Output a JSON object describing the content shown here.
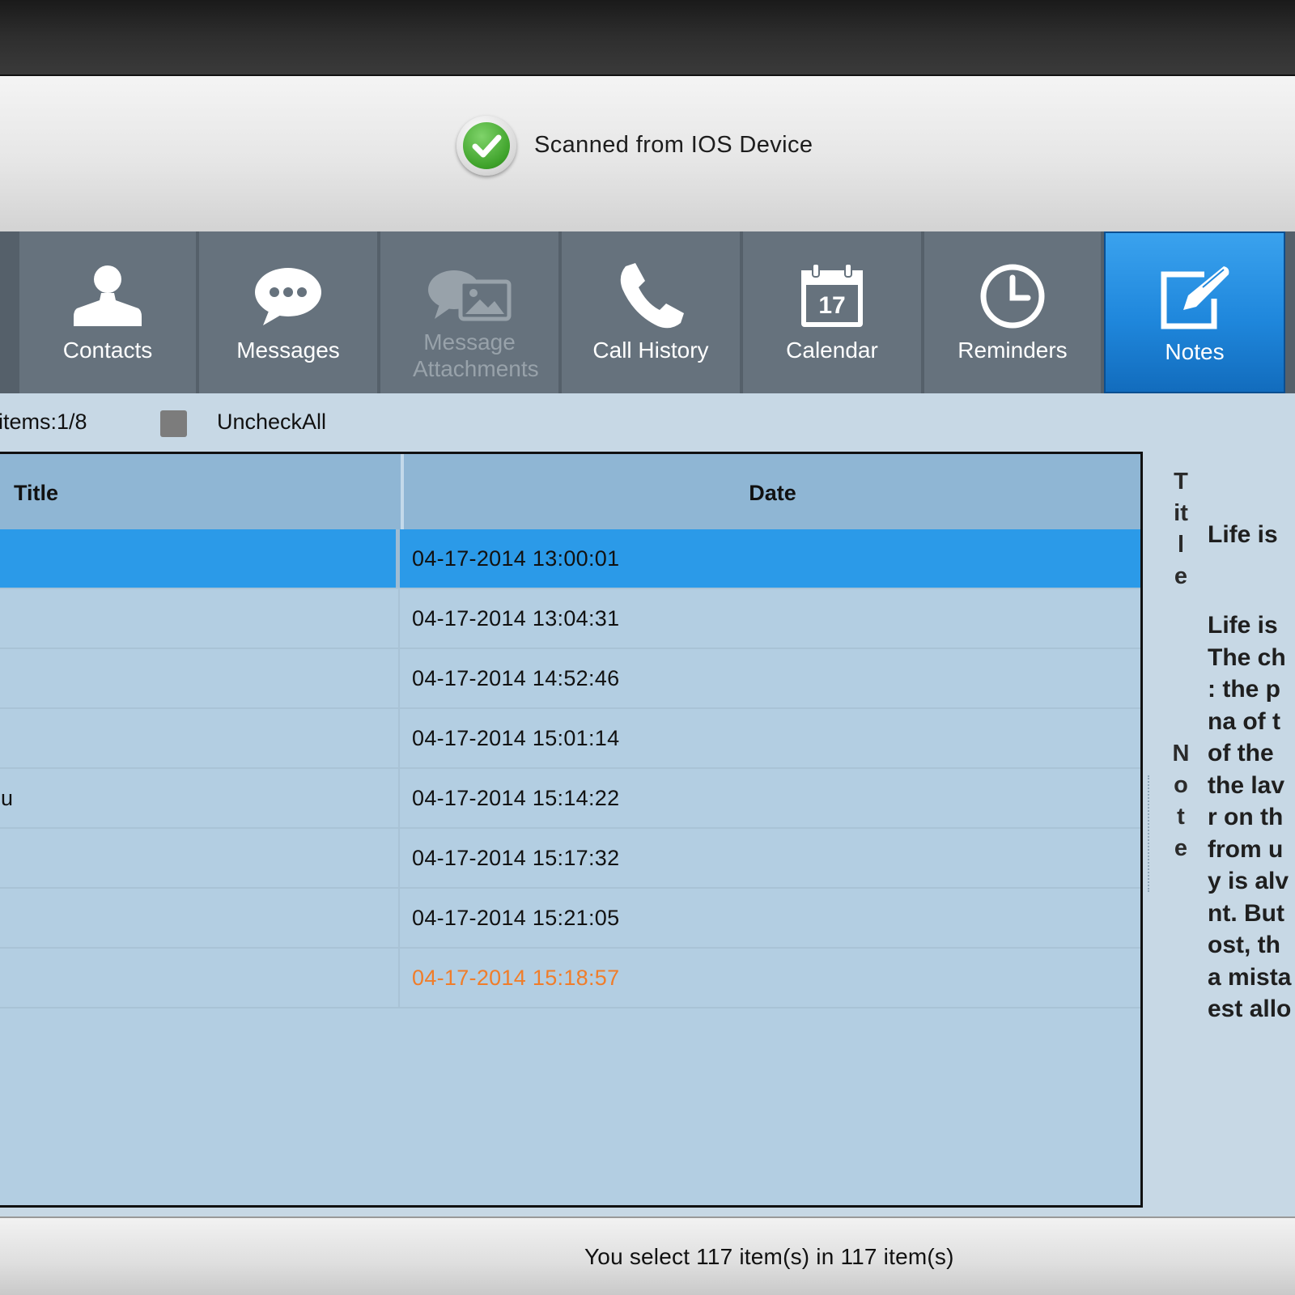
{
  "status": {
    "text": "Scanned from IOS Device"
  },
  "tabs": [
    {
      "label": "Contacts",
      "icon": "contacts-icon",
      "disabled": false,
      "active": false
    },
    {
      "label": "Messages",
      "icon": "messages-icon",
      "disabled": false,
      "active": false
    },
    {
      "label": "Message Attachments",
      "icon": "message-attachments-icon",
      "disabled": true,
      "active": false
    },
    {
      "label": "Call History",
      "icon": "phone-icon",
      "disabled": false,
      "active": false
    },
    {
      "label": "Calendar",
      "icon": "calendar-icon",
      "day": "17",
      "disabled": false,
      "active": false
    },
    {
      "label": "Reminders",
      "icon": "clock-icon",
      "disabled": false,
      "active": false
    },
    {
      "label": "Notes",
      "icon": "notes-icon",
      "disabled": false,
      "active": true
    }
  ],
  "toolbar": {
    "items_count": "items:1/8",
    "uncheck_all_label": "UncheckAll"
  },
  "table": {
    "columns": [
      "Title",
      "Date"
    ],
    "rows": [
      {
        "title": "",
        "date": "04-17-2014 13:00:01",
        "selected": true,
        "highlight": false
      },
      {
        "title": "",
        "date": "04-17-2014 13:04:31",
        "selected": false,
        "highlight": false
      },
      {
        "title": "",
        "date": "04-17-2014 14:52:46",
        "selected": false,
        "highlight": false
      },
      {
        "title": "",
        "date": "04-17-2014 15:01:14",
        "selected": false,
        "highlight": false
      },
      {
        "title": "u",
        "date": "04-17-2014 15:14:22",
        "selected": false,
        "highlight": false
      },
      {
        "title": "",
        "date": "04-17-2014 15:17:32",
        "selected": false,
        "highlight": false
      },
      {
        "title": "",
        "date": "04-17-2014 15:21:05",
        "selected": false,
        "highlight": false
      },
      {
        "title": "",
        "date": "04-17-2014 15:18:57",
        "selected": false,
        "highlight": true
      }
    ]
  },
  "detail": {
    "title_label": [
      "T",
      "it",
      "l",
      "e"
    ],
    "title_value": "Life is",
    "note_label": [
      "N",
      "o",
      "t",
      "e"
    ],
    "note_lines": [
      "Life is",
      "The ch",
      ": the p",
      "na of t",
      "of the",
      "the lav",
      "r on th",
      "from u",
      "y is alv",
      "nt. But",
      "ost, th",
      "a mista",
      "est allo"
    ]
  },
  "footer": {
    "text": "You select 117 item(s) in 117 item(s)"
  },
  "colors": {
    "active_tab": "#1f87dc",
    "selected_row": "#2b9ae8",
    "highlight_date": "#f07d2a"
  }
}
